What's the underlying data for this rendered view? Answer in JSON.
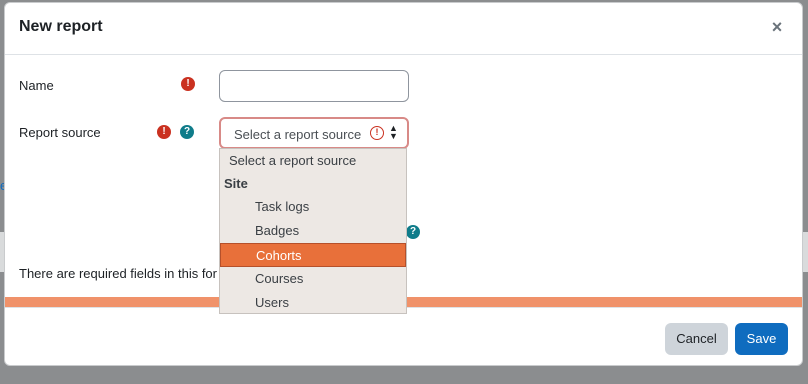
{
  "modal": {
    "title": "New report",
    "close_glyph": "×"
  },
  "form": {
    "name": {
      "label": "Name",
      "value": ""
    },
    "report_source": {
      "label": "Report source",
      "selected": "Select a report source"
    },
    "required_note": "There are required fields in this for"
  },
  "dropdown": {
    "placeholder": "Select a report source",
    "group_label": "Site",
    "options": [
      "Task logs",
      "Badges",
      "Cohorts",
      "Courses",
      "Users"
    ],
    "highlighted": "Cohorts"
  },
  "footer": {
    "cancel_label": "Cancel",
    "save_label": "Save"
  },
  "icons": {
    "required": "exclamation-circle-icon",
    "help": "question-circle-icon"
  },
  "colors": {
    "required": "#ca3120",
    "help": "#0f7c8a",
    "primary": "#0f6cbf",
    "highlight": "#e8703a"
  },
  "backdrop": {
    "link_fragment": "e"
  }
}
